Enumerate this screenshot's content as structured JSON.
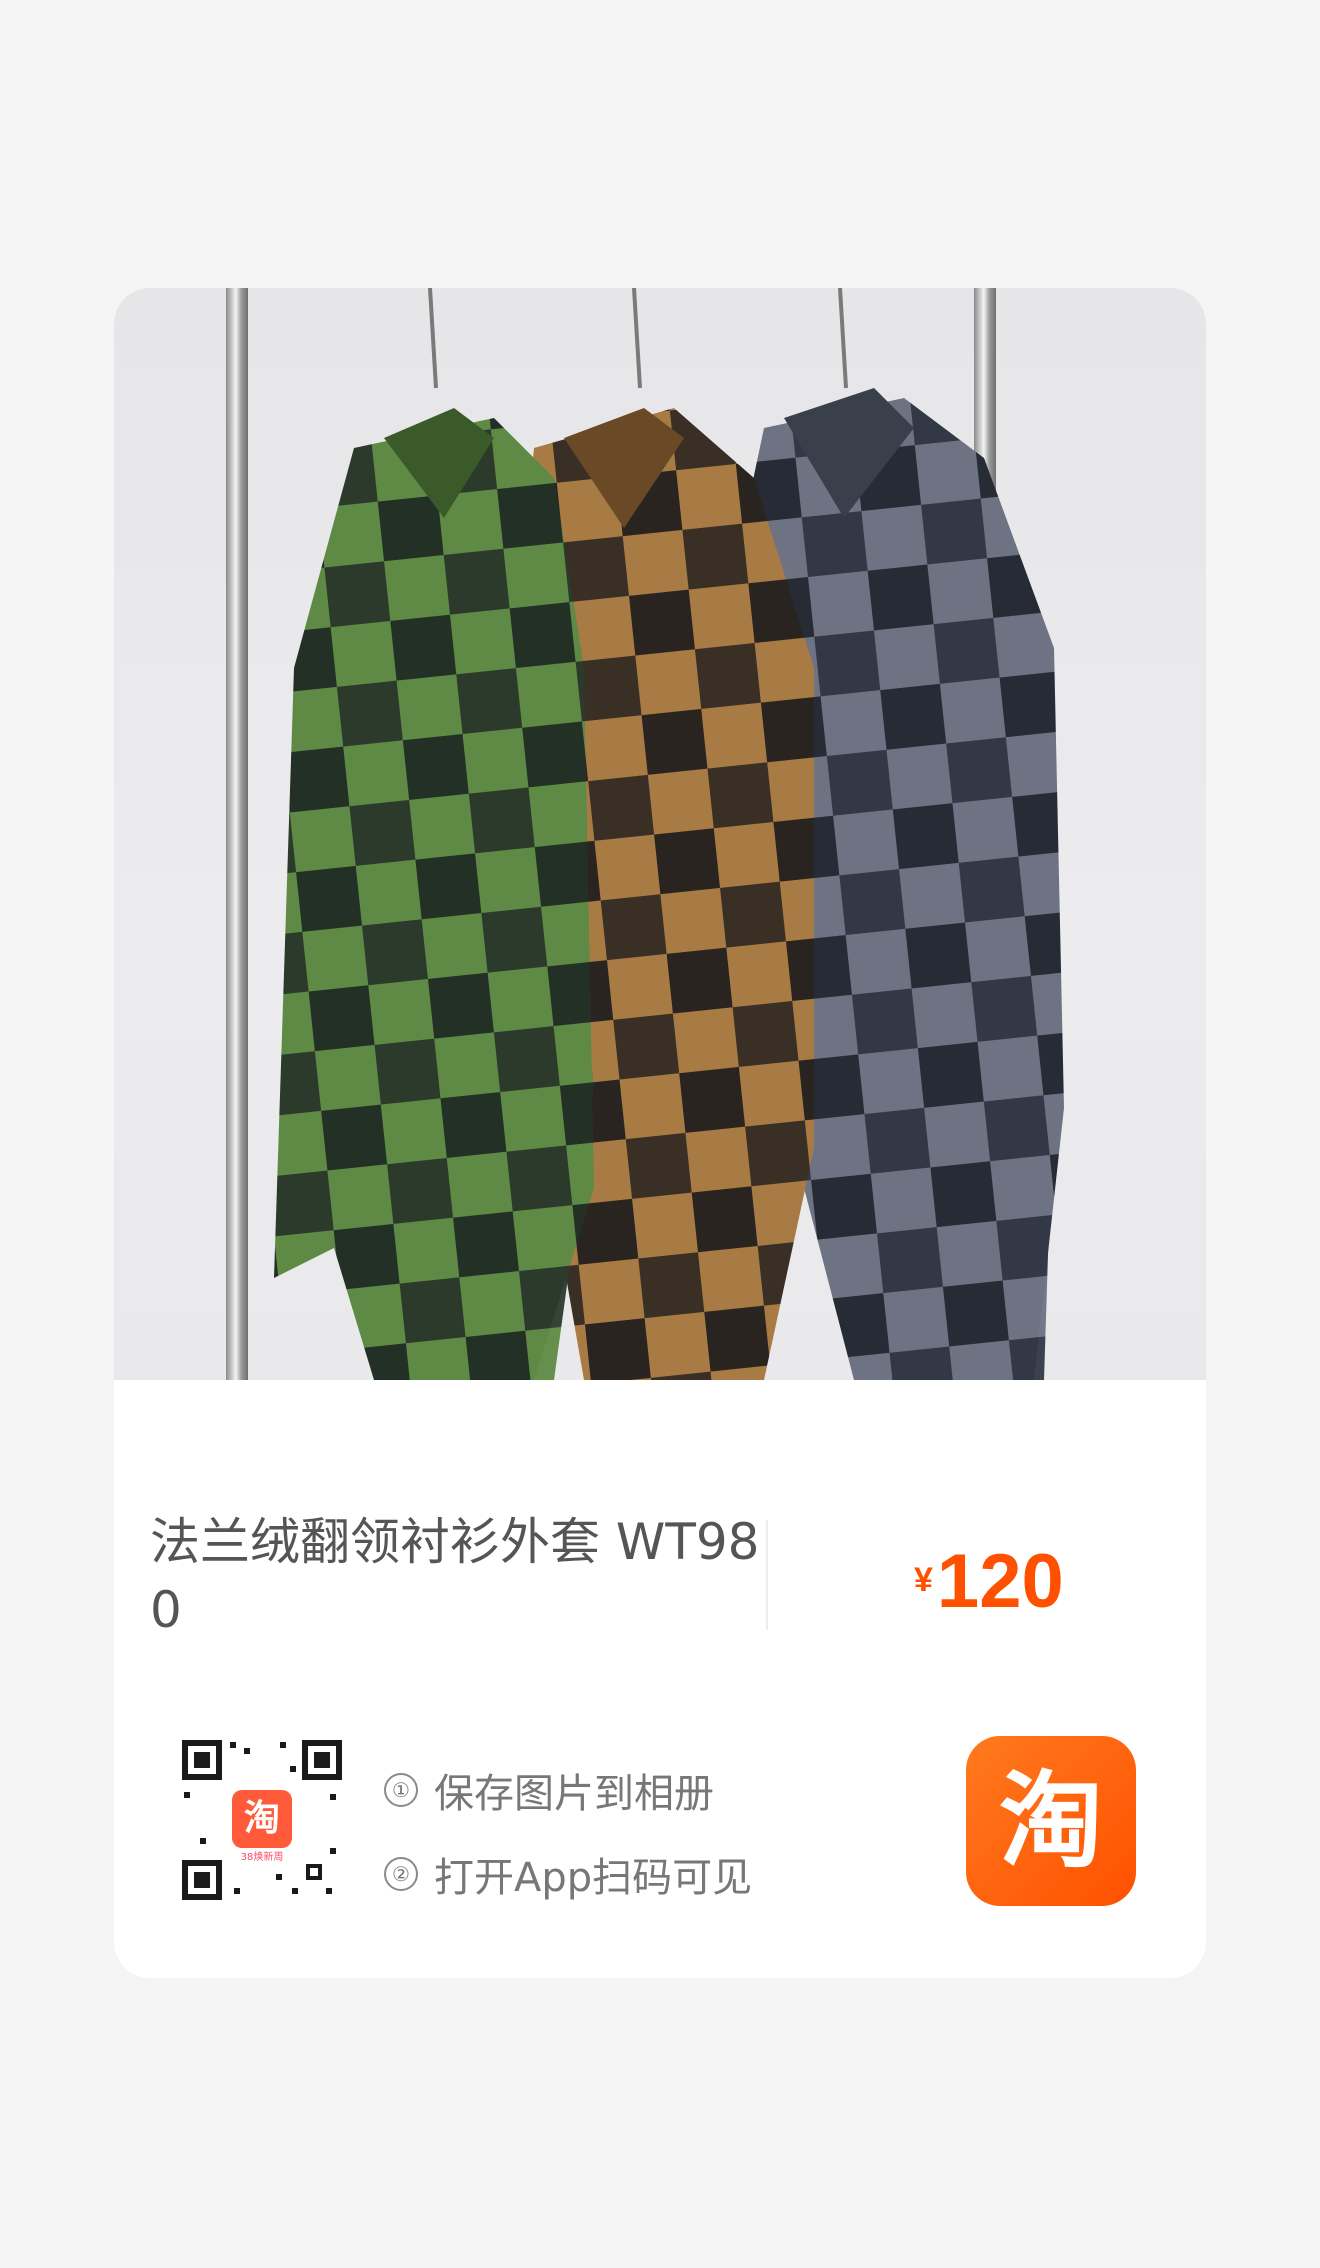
{
  "product": {
    "title": "法兰绒翻领衬衫外套 WT980",
    "price_currency": "¥",
    "price_value": "120",
    "image_icon": "plaid-shirt-jackets-photo"
  },
  "share": {
    "qr_icon": "qr-code",
    "qr_badge_char": "淘",
    "qr_badge_caption": "38焕新周",
    "steps": [
      {
        "num": "①",
        "text": "保存图片到相册"
      },
      {
        "num": "②",
        "text": "打开App扫码可见"
      }
    ],
    "app_icon_char": "淘"
  },
  "colors": {
    "accent": "#ff5000",
    "background": "#f5f5f5",
    "card": "#ffffff",
    "text": "#555555",
    "secondary_text": "#777777"
  }
}
